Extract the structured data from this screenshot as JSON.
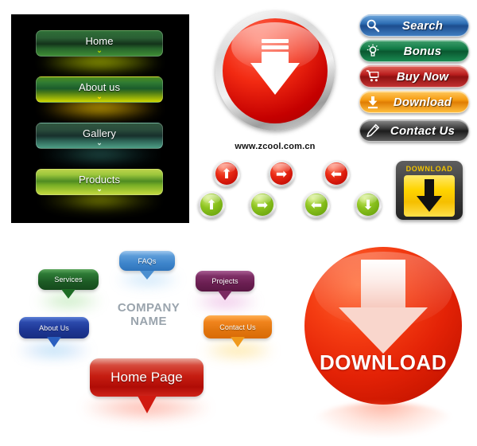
{
  "page": {
    "watermark": "www.zcool.com.cn",
    "background": "#ffffff"
  },
  "menu_panel": {
    "background": "#000000",
    "items": [
      {
        "label": "Home",
        "chevron": "⌄",
        "accent": "#2f6f38"
      },
      {
        "label": "About us",
        "chevron": "⌄",
        "accent": "#cfd800"
      },
      {
        "label": "Gallery",
        "chevron": "⌄",
        "accent": "#4e9f86"
      },
      {
        "label": "Products",
        "chevron": "⌄",
        "accent": "#bad24a"
      }
    ]
  },
  "download_circle": {
    "name": "download-circle-button",
    "color": "#e30b0b",
    "icon": "download-arrow-icon"
  },
  "pill_buttons": [
    {
      "label": "Search",
      "icon": "magnifier-icon",
      "color": "#2e6fb5"
    },
    {
      "label": "Bonus",
      "icon": "lightbulb-icon",
      "color": "#107a45"
    },
    {
      "label": "Buy Now",
      "icon": "shopping-cart-icon",
      "color": "#bb1f1f"
    },
    {
      "label": "Download",
      "icon": "download-icon",
      "color": "#f59b11"
    },
    {
      "label": "Contact Us",
      "icon": "pen-icon",
      "color": "#3a3a3a"
    }
  ],
  "arrow_buttons": {
    "row_red": [
      {
        "icon": "arrow-up-icon",
        "glyph": "⬆",
        "color": "#ea2a14"
      },
      {
        "icon": "arrow-right-icon",
        "glyph": "➡",
        "color": "#ea2a14"
      },
      {
        "icon": "arrow-left-icon",
        "glyph": "⬅",
        "color": "#ea2a14"
      }
    ],
    "row_green": [
      {
        "icon": "arrow-up-icon",
        "glyph": "⬆",
        "color": "#8dc41f"
      },
      {
        "icon": "arrow-right-icon",
        "glyph": "➡",
        "color": "#8dc41f"
      },
      {
        "icon": "arrow-left-icon",
        "glyph": "⬅",
        "color": "#8dc41f"
      },
      {
        "icon": "arrow-down-icon",
        "glyph": "⬇",
        "color": "#8dc41f"
      }
    ]
  },
  "download_box": {
    "caption": "DOWNLOAD",
    "frame_color": "#3a3a3a",
    "fill_color": "#ffd400",
    "icon": "download-arrow-icon"
  },
  "bubbles": [
    {
      "label": "Services",
      "color": "#2d7a35",
      "glow": "#79d46a"
    },
    {
      "label": "FAQs",
      "color": "#5b9bd8",
      "glow": "#7fc2f2"
    },
    {
      "label": "Projects",
      "color": "#7e2f66",
      "glow": "#e06fd0"
    },
    {
      "label": "About Us",
      "color": "#2b49ab",
      "glow": "#5fbff0"
    },
    {
      "label": "Contact Us",
      "color": "#f0841d",
      "glow": "#ffd13a"
    },
    {
      "label": "Home Page",
      "color": "#c61e12",
      "glow": "#ff6a52"
    }
  ],
  "company": {
    "line1": "COMPANY",
    "line2": "NAME",
    "color": "#9aa4ad"
  },
  "download_sphere": {
    "label": "DOWNLOAD",
    "color": "#e32206",
    "icon": "download-arrow-icon"
  }
}
